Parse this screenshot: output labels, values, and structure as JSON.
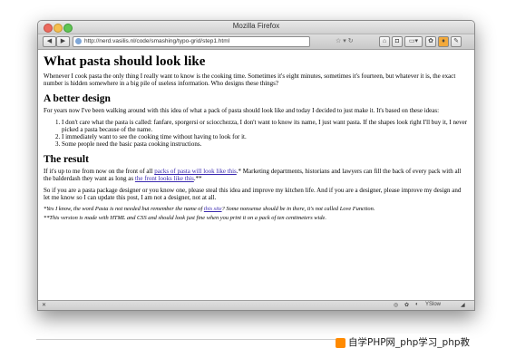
{
  "window": {
    "title": "Mozilla Firefox"
  },
  "toolbar": {
    "url": "http://nerd.vasilis.nl/code/smashing/typo-grid/step1.html"
  },
  "article": {
    "heading": "What pasta should look like",
    "intro": "Whenever I cook pasta the only thing I really want to know is the cooking time. Sometimes it's eight minutes, sometimes it's fourteen, but whatever it is, the exact number is hidden somewhere in a big pile of useless information. Who designs these things?",
    "section1": {
      "heading": "A better design",
      "intro": "For years now I've been walking around with this idea of what a pack of pasta should look like and today I decided to just make it. It's based on these ideas:",
      "items": [
        "I don't care what the pasta is called: fanfare, sporgersi or sciocchezza, I don't want to know its name, I just want pasta. If the shapes look right I'll buy it, I never picked a pasta because of the name.",
        "I immediately want to see the cooking time without having to look for it.",
        "Some people need the basic pasta cooking instructions."
      ]
    },
    "section2": {
      "heading": "The result",
      "p1_before": "If it's up to me from now on the front of all ",
      "p1_link1": "packs of pasta will look like this",
      "p1_mid": ".* Marketing departments, historians and lawyers can fill the back of every pack with all the balderdash they want as long as ",
      "p1_link2": "the front looks like this",
      "p1_after": ".**",
      "p2": "So if you are a pasta package designer or you know one, please steal this idea and improve my kitchen life. And if you are a designer, please improve my design and let me know so I can update this post, I am not a designer, not at all.",
      "note1_before": "*Yes I know, the word Pasta is not needed but remember the name of ",
      "note1_link": "this site",
      "note1_after": "? Some nonsense should be in there, it's not called Love Function.",
      "note2": "**This version is made with HTML and CSS and should look just fine when you print it on a pack of ten centimeters wide."
    }
  },
  "statusbar": {
    "addon": "YSlow"
  },
  "watermark": {
    "text": "自学PHP网_php学习_php教"
  }
}
